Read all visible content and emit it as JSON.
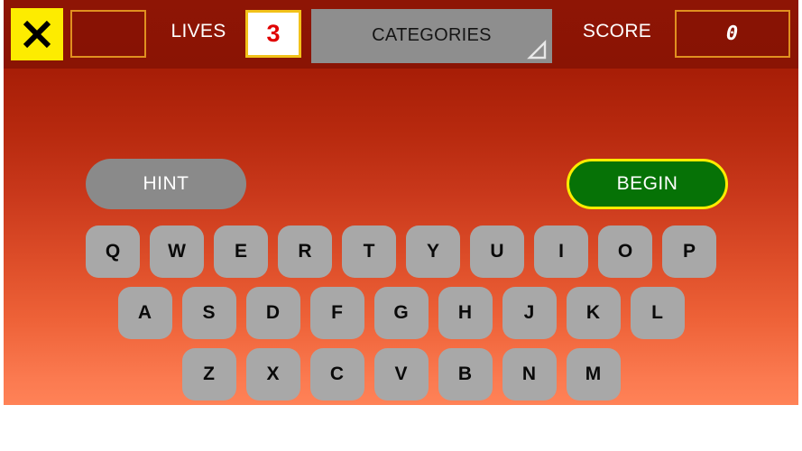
{
  "topbar": {
    "close_icon": "close-x-icon",
    "word_box_value": "",
    "lives_label": "LIVES",
    "lives_value": "3",
    "categories_label": "CATEGORIES",
    "categories_options": [
      "CATEGORIES"
    ],
    "spinner_caret_icon": "spinner-triangle-icon",
    "score_label": "SCORE",
    "score_value": "0"
  },
  "actions": {
    "hint_label": "HINT",
    "begin_label": "BEGIN"
  },
  "keyboard": {
    "rows": [
      [
        "Q",
        "W",
        "E",
        "R",
        "T",
        "Y",
        "U",
        "I",
        "O",
        "P"
      ],
      [
        "A",
        "S",
        "D",
        "F",
        "G",
        "H",
        "J",
        "K",
        "L"
      ],
      [
        "Z",
        "X",
        "C",
        "V",
        "B",
        "N",
        "M"
      ]
    ]
  },
  "colors": {
    "background_top": "#8e1505",
    "background_bottom": "#ff8257",
    "topbar": "#8a1404",
    "close_button": "#fdec00",
    "lives_value": "#e00000",
    "lives_border": "#f2c21a",
    "box_border": "#e09020",
    "spinner": "#8e8e8e",
    "hint": "#8a8a8a",
    "begin_fill": "#067206",
    "begin_border": "#fdec00",
    "key_fill": "#a8a8a8",
    "key_text": "#0a0a0a"
  }
}
